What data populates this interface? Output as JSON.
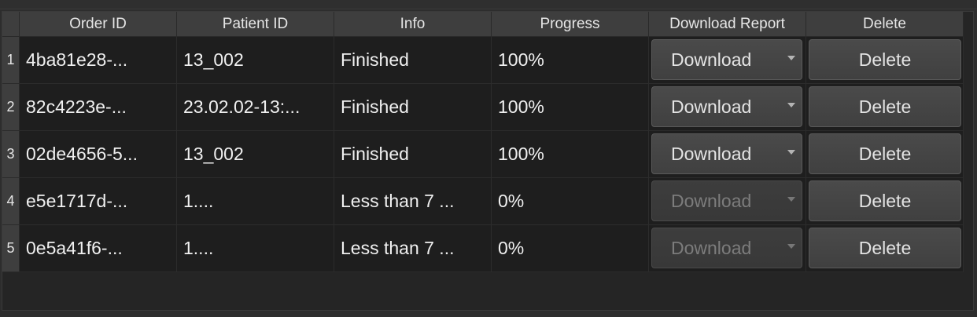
{
  "table": {
    "headers": [
      "Order ID",
      "Patient ID",
      "Info",
      "Progress",
      "Download Report",
      "Delete"
    ],
    "rows": [
      {
        "num": "1",
        "order_id": "4ba81e28-...",
        "patient_id": "13_002",
        "info": "Finished",
        "progress": "100%",
        "download_label": "Download",
        "download_enabled": true,
        "delete_label": "Delete"
      },
      {
        "num": "2",
        "order_id": "82c4223e-...",
        "patient_id": "23.02.02-13:...",
        "info": "Finished",
        "progress": "100%",
        "download_label": "Download",
        "download_enabled": true,
        "delete_label": "Delete"
      },
      {
        "num": "3",
        "order_id": "02de4656-5...",
        "patient_id": "13_002",
        "info": "Finished",
        "progress": "100%",
        "download_label": "Download",
        "download_enabled": true,
        "delete_label": "Delete"
      },
      {
        "num": "4",
        "order_id": "e5e1717d-...",
        "patient_id": "1....",
        "info": "Less than 7 ...",
        "progress": "0%",
        "download_label": "Download",
        "download_enabled": false,
        "delete_label": "Delete"
      },
      {
        "num": "5",
        "order_id": "0e5a41f6-...",
        "patient_id": "1....",
        "info": "Less than 7 ...",
        "progress": "0%",
        "download_label": "Download",
        "download_enabled": false,
        "delete_label": "Delete"
      }
    ]
  },
  "icons": {
    "dropdown": "chevron-down-icon"
  }
}
